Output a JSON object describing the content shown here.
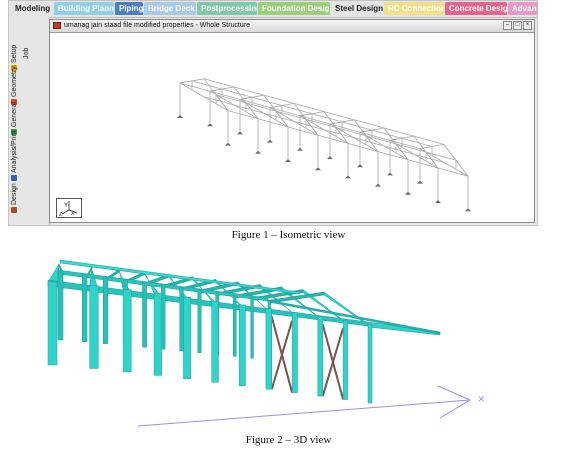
{
  "menu_tabs": [
    {
      "label": "Modeling",
      "style": "plain"
    },
    {
      "label": "Building Planner",
      "style": "color",
      "color": "#8fd0e8"
    },
    {
      "label": "Piping",
      "style": "color",
      "color": "#4a7fc0"
    },
    {
      "label": "Bridge Deck",
      "style": "color",
      "color": "#a9c9e6"
    },
    {
      "label": "Postprocessing",
      "style": "color",
      "color": "#7fc9a6"
    },
    {
      "label": "Foundation Design",
      "style": "color",
      "color": "#9ad07a"
    },
    {
      "label": "Steel Design",
      "style": "plain"
    },
    {
      "label": "RC Connection",
      "style": "color",
      "color": "#f2e08a"
    },
    {
      "label": "Concrete Design",
      "style": "color",
      "color": "#e6648c"
    },
    {
      "label": "Advanced Slab",
      "style": "color",
      "color": "#e69acb"
    }
  ],
  "side_tabs": [
    {
      "label": "Setup",
      "icon_color": "#d9a400"
    },
    {
      "label": "Geometry",
      "icon_color": "#d94a1a"
    },
    {
      "label": "General",
      "icon_color": "#2c9a3c"
    },
    {
      "label": "Analysis/Print",
      "icon_color": "#3561b5"
    },
    {
      "label": "Design",
      "icon_color": "#b14b1f"
    }
  ],
  "side_top_label": "Job",
  "window": {
    "title": "umanag jain staad file modified properties - Whole Structure",
    "buttons": [
      "–",
      "□",
      "×"
    ]
  },
  "captions": {
    "figure1": "Figure 1 – Isometric view",
    "figure2": "Figure 2 – 3D view"
  },
  "colors": {
    "member_3d": "#2fd3c9",
    "bracing_3d": "#7a5248",
    "wireframe": "#a9a9a9",
    "support": "#6a6a6a",
    "axis": "#9b8fe0"
  }
}
